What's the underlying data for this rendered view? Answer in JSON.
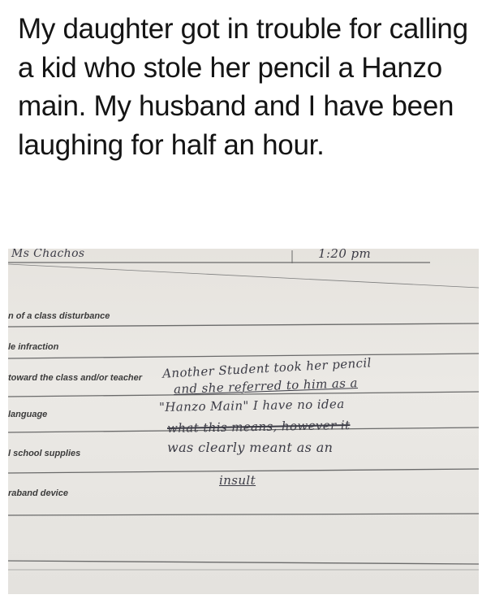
{
  "caption": "My daughter got in trouble for calling a kid who stole her pencil a Hanzo main. My husband and I have been laughing for half an hour.",
  "form": {
    "teacher_name": "Ms Chachos",
    "time": "1:20 pm",
    "rows": [
      "n of a class disturbance",
      "le infraction",
      "toward the class and/or teacher",
      "language",
      "l school supplies",
      "raband device"
    ]
  },
  "handwriting": {
    "lines": [
      "Another Student took her pencil",
      "and she referred to him as a",
      "\"Hanzo Main\" I have no idea",
      "what this means, however it",
      "was clearly meant as an",
      "insult"
    ]
  },
  "colors": {
    "text": "#141414",
    "paper": "#e8e6e2",
    "ink": "#3c3c46"
  }
}
